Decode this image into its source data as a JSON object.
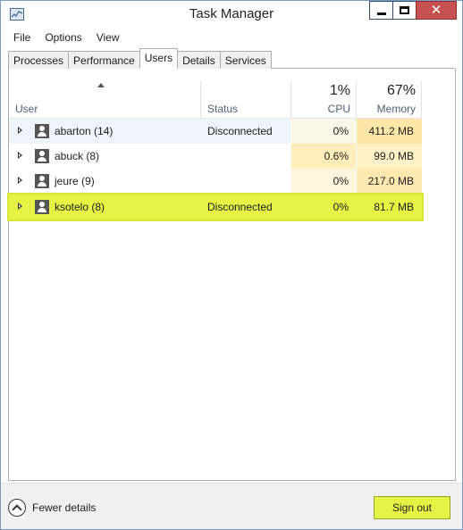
{
  "window": {
    "title": "Task Manager",
    "icon": "task-manager-icon"
  },
  "menu": [
    "File",
    "Options",
    "View"
  ],
  "tabs": [
    "Processes",
    "Performance",
    "Users",
    "Details",
    "Services"
  ],
  "active_tab": "Users",
  "table": {
    "headers": {
      "user": "User",
      "status": "Status",
      "cpu_total": "1%",
      "cpu": "CPU",
      "memory_total": "67%",
      "memory": "Memory"
    },
    "rows": [
      {
        "user": "abarton (14)",
        "status": "Disconnected",
        "cpu": "0%",
        "memory": "411.2 MB"
      },
      {
        "user": "abuck (8)",
        "status": "",
        "cpu": "0.6%",
        "memory": "99.0 MB"
      },
      {
        "user": "jeure (9)",
        "status": "",
        "cpu": "0%",
        "memory": "217.0 MB"
      },
      {
        "user": "ksotelo (8)",
        "status": "Disconnected",
        "cpu": "0%",
        "memory": "81.7 MB"
      }
    ],
    "selected_row": 3
  },
  "footer": {
    "fewer_details": "Fewer details",
    "sign_out": "Sign out"
  },
  "colors": {
    "highlight": "#e6f244",
    "mem_heat_high": "#fde7a8",
    "mem_heat_mid": "#fff2c6",
    "cpu_heat": "#fff6dd",
    "close_button": "#c75050"
  }
}
